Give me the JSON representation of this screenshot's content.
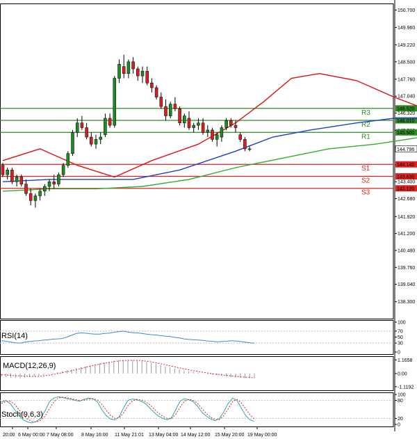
{
  "chart_data": {
    "type": "candlestick",
    "price_axis": {
      "ylim": [
        137.58,
        150.98
      ],
      "ticks": [
        "150.700",
        "149.960",
        "149.220",
        "148.500",
        "147.760",
        "147.040",
        "146.320",
        "145.580",
        "144.860",
        "144.120",
        "143.400",
        "142.680",
        "141.920",
        "141.200",
        "140.480",
        "139.760",
        "139.040",
        "138.300"
      ],
      "current_price": "144.796"
    },
    "levels": [
      {
        "name": "R3",
        "value": "146.520",
        "color": "#2e8b22"
      },
      {
        "name": "R2",
        "value": "146.010",
        "color": "#2e8b22"
      },
      {
        "name": "R1",
        "value": "145.500",
        "color": "#2e8b22"
      },
      {
        "name": "S1",
        "value": "144.140",
        "color": "#dd2222"
      },
      {
        "name": "S2",
        "value": "143.630",
        "color": "#dd2222"
      },
      {
        "name": "S3",
        "value": "143.120",
        "color": "#dd2222"
      }
    ],
    "candles": [
      [
        144.1,
        144.2,
        143.6,
        143.7
      ],
      [
        143.7,
        144.0,
        143.5,
        143.9
      ],
      [
        143.9,
        144.0,
        143.3,
        143.4
      ],
      [
        143.4,
        143.7,
        143.2,
        143.6
      ],
      [
        143.6,
        143.7,
        143.2,
        143.3
      ],
      [
        143.3,
        143.5,
        142.8,
        142.9
      ],
      [
        142.9,
        143.1,
        142.4,
        142.6
      ],
      [
        142.6,
        142.9,
        142.3,
        142.8
      ],
      [
        142.8,
        143.1,
        142.6,
        143.0
      ],
      [
        143.0,
        143.3,
        142.8,
        143.2
      ],
      [
        143.2,
        143.5,
        143.0,
        143.4
      ],
      [
        143.4,
        143.7,
        143.1,
        143.3
      ],
      [
        143.3,
        143.8,
        143.2,
        143.7
      ],
      [
        143.7,
        144.2,
        143.6,
        144.1
      ],
      [
        144.1,
        144.7,
        144.0,
        144.6
      ],
      [
        144.6,
        145.6,
        144.5,
        145.5
      ],
      [
        145.5,
        146.1,
        145.3,
        145.9
      ],
      [
        145.9,
        146.2,
        145.6,
        145.7
      ],
      [
        145.7,
        145.9,
        145.2,
        145.3
      ],
      [
        145.3,
        145.5,
        144.9,
        145.0
      ],
      [
        145.0,
        145.4,
        144.8,
        145.2
      ],
      [
        145.2,
        145.5,
        145.0,
        145.3
      ],
      [
        145.4,
        146.3,
        145.3,
        146.1
      ],
      [
        146.1,
        146.3,
        145.7,
        145.8
      ],
      [
        145.8,
        147.9,
        145.7,
        147.8
      ],
      [
        147.8,
        148.6,
        147.6,
        148.4
      ],
      [
        148.3,
        148.8,
        147.8,
        148.0
      ],
      [
        148.0,
        148.6,
        147.8,
        148.5
      ],
      [
        148.5,
        148.7,
        148.0,
        148.2
      ],
      [
        148.2,
        148.3,
        147.7,
        147.9
      ],
      [
        147.9,
        148.3,
        147.6,
        148.1
      ],
      [
        148.1,
        148.3,
        147.5,
        147.6
      ],
      [
        147.6,
        147.8,
        147.2,
        147.4
      ],
      [
        147.4,
        147.5,
        146.9,
        147.0
      ],
      [
        147.0,
        147.2,
        146.5,
        146.6
      ],
      [
        146.6,
        146.9,
        146.0,
        146.2
      ],
      [
        146.2,
        146.8,
        146.1,
        146.7
      ],
      [
        146.7,
        147.0,
        146.4,
        146.5
      ],
      [
        146.5,
        146.6,
        145.8,
        145.9
      ],
      [
        145.9,
        146.3,
        145.7,
        146.2
      ],
      [
        146.1,
        146.4,
        145.6,
        145.7
      ],
      [
        145.7,
        145.9,
        145.5,
        145.8
      ],
      [
        145.8,
        146.1,
        145.6,
        145.9
      ],
      [
        145.9,
        146.1,
        145.4,
        145.5
      ],
      [
        145.5,
        145.8,
        145.3,
        145.6
      ],
      [
        145.6,
        145.7,
        145.1,
        145.2
      ],
      [
        145.2,
        145.5,
        144.9,
        145.4
      ],
      [
        145.3,
        145.8,
        145.1,
        145.7
      ],
      [
        145.7,
        146.1,
        145.6,
        146.0
      ],
      [
        146.0,
        146.1,
        145.7,
        145.8
      ],
      [
        145.8,
        146.0,
        145.5,
        145.7
      ],
      [
        145.4,
        145.5,
        145.1,
        145.2
      ],
      [
        145.2,
        145.3,
        144.7,
        144.8
      ],
      [
        144.8,
        144.9,
        144.7,
        144.8
      ]
    ],
    "series": [
      {
        "name": "",
        "color": "#dd1111",
        "values": [
          [
            0,
            144.3
          ],
          [
            8,
            144.8
          ],
          [
            16,
            144.1
          ],
          [
            24,
            143.6
          ],
          [
            32,
            144.3
          ],
          [
            42,
            145.0
          ],
          [
            50,
            145.9
          ],
          [
            56,
            146.8
          ],
          [
            62,
            147.8
          ],
          [
            68,
            148.0
          ],
          [
            76,
            147.7
          ],
          [
            84,
            147.0
          ],
          [
            92,
            146.4
          ],
          [
            100,
            145.9
          ],
          [
            106,
            145.6
          ],
          [
            110,
            145.3
          ]
        ]
      },
      {
        "name": "",
        "color": "#1a3fcc",
        "values": [
          [
            0,
            143.4
          ],
          [
            10,
            143.5
          ],
          [
            18,
            143.5
          ],
          [
            28,
            143.5
          ],
          [
            38,
            143.9
          ],
          [
            50,
            144.7
          ],
          [
            58,
            145.3
          ],
          [
            66,
            145.6
          ],
          [
            76,
            145.9
          ],
          [
            84,
            146.1
          ],
          [
            92,
            146.1
          ],
          [
            100,
            146.2
          ],
          [
            106,
            146.3
          ],
          [
            110,
            146.3
          ]
        ]
      },
      {
        "name": "",
        "color": "#33aa33",
        "values": [
          [
            0,
            143.0
          ],
          [
            10,
            143.1
          ],
          [
            20,
            143.1
          ],
          [
            30,
            143.2
          ],
          [
            40,
            143.5
          ],
          [
            50,
            144.0
          ],
          [
            60,
            144.4
          ],
          [
            70,
            144.8
          ],
          [
            80,
            145.0
          ],
          [
            90,
            145.3
          ],
          [
            100,
            145.4
          ],
          [
            110,
            145.5
          ]
        ]
      }
    ],
    "x_labels": [
      "20:00",
      "6 May 00:00",
      "7 May 08:00",
      "8 May 16:00",
      "11 May 21:01",
      "13 May 04:00",
      "14 May 12:00",
      "15 May 20:00",
      "19 May 00:00"
    ],
    "rsi": {
      "label": "RSI(14)",
      "ylim": [
        0,
        100
      ],
      "ticks": [
        "100",
        "70",
        "50",
        "30",
        "0"
      ],
      "values": [
        38,
        36,
        33,
        31,
        30,
        33,
        35,
        37,
        38,
        40,
        41,
        43,
        44,
        45,
        50,
        56,
        62,
        64,
        63,
        61,
        60,
        60,
        62,
        63,
        66,
        68,
        70,
        67,
        65,
        64,
        62,
        60,
        58,
        57,
        55,
        53,
        52,
        49,
        47,
        44,
        42,
        41,
        40,
        39,
        37,
        36,
        34,
        35,
        36,
        38,
        37,
        35,
        33,
        31,
        30
      ]
    },
    "macd": {
      "label": "MACD(12,26,9)",
      "ticks": [
        "1.1658",
        "0.00",
        "-1.1192"
      ],
      "ylim": [
        -1.25,
        1.3
      ],
      "hist": [
        -0.25,
        -0.3,
        -0.35,
        -0.38,
        -0.4,
        -0.35,
        -0.3,
        -0.25,
        -0.2,
        -0.12,
        -0.05,
        0.05,
        0.12,
        0.2,
        0.28,
        0.36,
        0.45,
        0.55,
        0.62,
        0.7,
        0.78,
        0.86,
        0.94,
        1.02,
        1.08,
        1.12,
        1.15,
        1.16,
        1.14,
        1.1,
        1.04,
        0.98,
        0.9,
        0.82,
        0.72,
        0.62,
        0.52,
        0.42,
        0.34,
        0.26,
        0.2,
        0.14,
        0.08,
        0.02,
        -0.04,
        -0.1,
        -0.15,
        -0.2,
        -0.25,
        -0.3,
        -0.33,
        -0.36,
        -0.38,
        -0.4,
        -0.42
      ],
      "signal": [
        -0.1,
        -0.12,
        -0.15,
        -0.18,
        -0.2,
        -0.22,
        -0.24,
        -0.25,
        -0.24,
        -0.2,
        -0.15,
        -0.08,
        0.0,
        0.08,
        0.16,
        0.24,
        0.34,
        0.44,
        0.54,
        0.63,
        0.72,
        0.8,
        0.88,
        0.95,
        1.02,
        1.07,
        1.1,
        1.12,
        1.13,
        1.12,
        1.09,
        1.05,
        0.99,
        0.92,
        0.84,
        0.75,
        0.66,
        0.57,
        0.48,
        0.4,
        0.32,
        0.25,
        0.18,
        0.11,
        0.05,
        -0.01,
        -0.06,
        -0.11,
        -0.15,
        -0.2,
        -0.24,
        -0.28,
        -0.31,
        -0.33,
        -0.35
      ]
    },
    "stoch": {
      "label": "Stoch(9,6,3)",
      "ylim": [
        0,
        100
      ],
      "ticks": [
        "100",
        "80",
        "20",
        "0"
      ],
      "main": [
        75,
        80,
        70,
        50,
        30,
        15,
        8,
        5,
        10,
        20,
        45,
        75,
        88,
        92,
        90,
        86,
        84,
        80,
        78,
        84,
        88,
        85,
        76,
        50,
        30,
        18,
        15,
        25,
        55,
        80,
        85,
        82,
        78,
        70,
        55,
        40,
        28,
        20,
        15,
        22,
        50,
        78,
        86,
        82,
        76,
        60,
        40,
        28,
        18,
        12,
        20,
        42,
        70,
        88,
        80,
        55,
        30,
        15,
        10
      ],
      "signal": [
        70,
        76,
        78,
        68,
        50,
        32,
        18,
        10,
        8,
        14,
        28,
        52,
        75,
        88,
        91,
        89,
        86,
        83,
        80,
        81,
        85,
        86,
        82,
        68,
        48,
        30,
        20,
        22,
        38,
        62,
        78,
        84,
        82,
        76,
        66,
        52,
        38,
        27,
        20,
        20,
        34,
        58,
        78,
        84,
        80,
        70,
        52,
        36,
        24,
        16,
        16,
        30,
        52,
        76,
        84,
        72,
        52,
        32,
        18
      ]
    }
  }
}
